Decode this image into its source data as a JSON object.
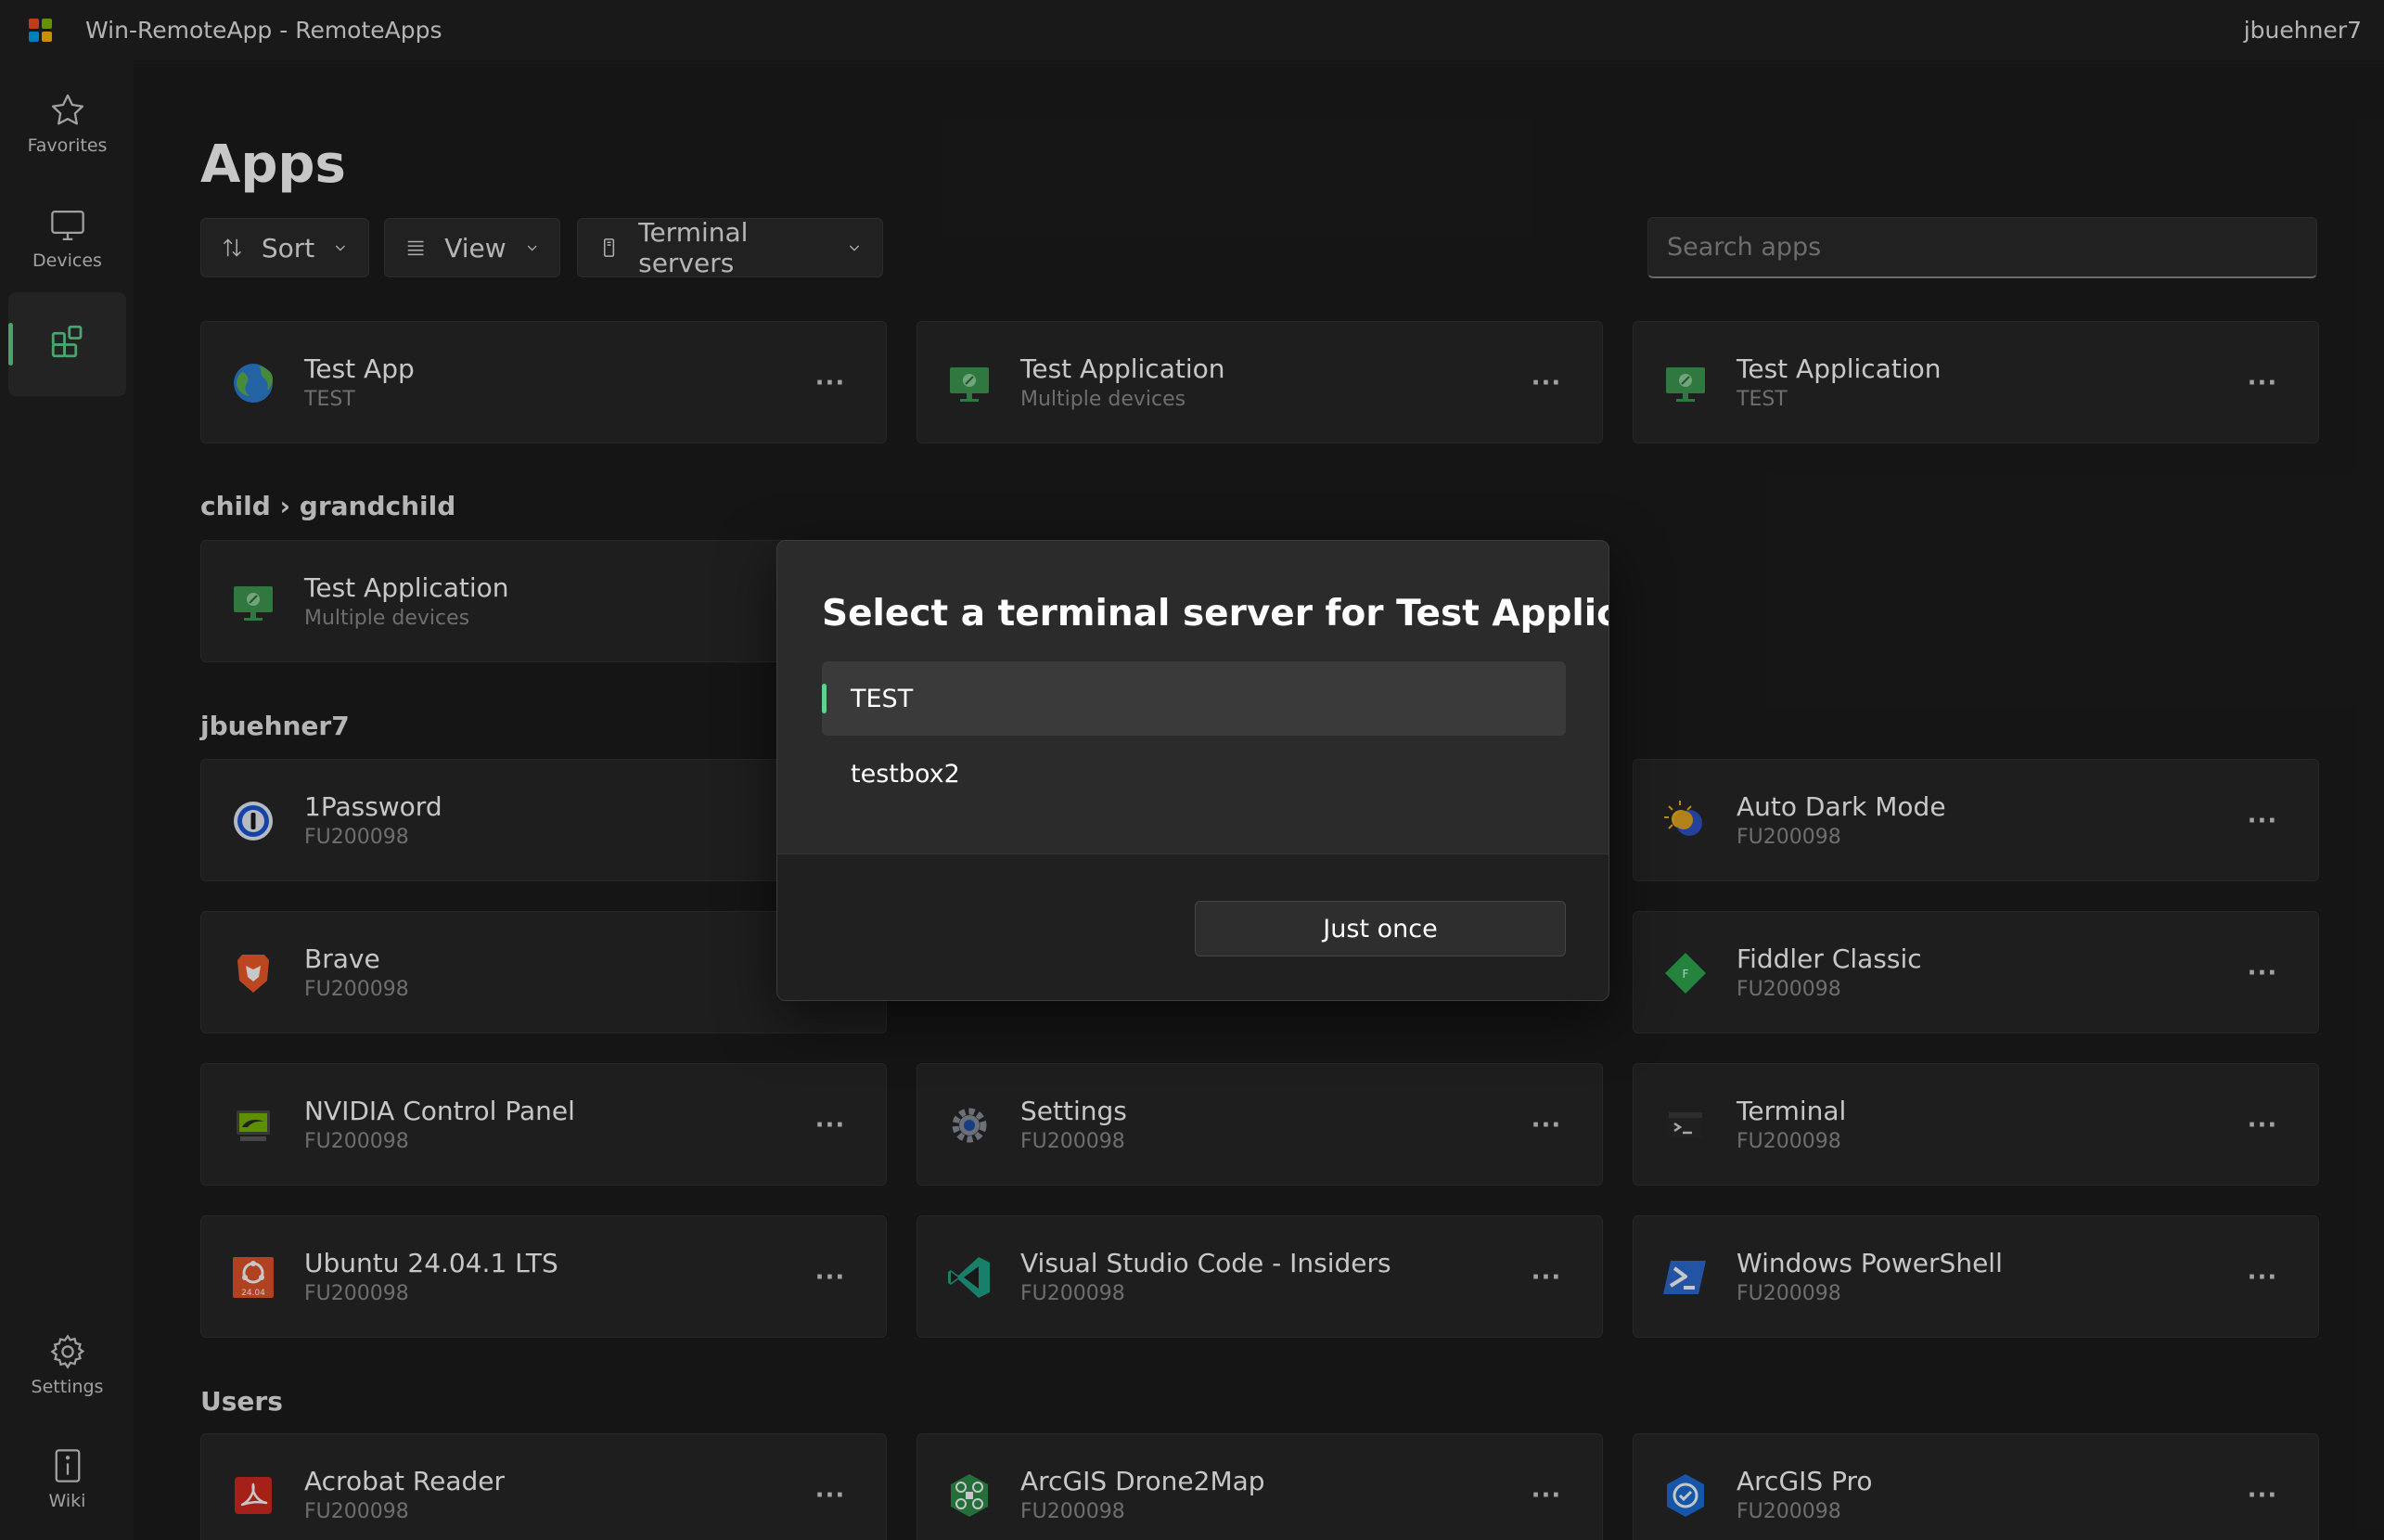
{
  "window": {
    "title": "Win-RemoteApp - RemoteApps",
    "user": "jbuehner7"
  },
  "sidebar": {
    "items": [
      {
        "label": "Favorites",
        "icon": "star-icon"
      },
      {
        "label": "Devices",
        "icon": "monitor-icon"
      },
      {
        "label": "",
        "icon": "apps-icon",
        "active": true
      },
      {
        "label": "Settings",
        "icon": "gear-icon"
      },
      {
        "label": "Wiki",
        "icon": "info-icon"
      }
    ]
  },
  "main": {
    "title": "Apps",
    "toolbar": {
      "sort_label": "Sort",
      "view_label": "View",
      "servers_label": "Terminal servers"
    },
    "search": {
      "placeholder": "Search apps",
      "value": ""
    },
    "sections": [
      {
        "label": ""
      },
      {
        "label": "child › grandchild"
      },
      {
        "label": "jbuehner7"
      },
      {
        "label": "Users"
      }
    ],
    "cards": [
      {
        "name": "Test App",
        "sub": "TEST",
        "icon": "globe-icon"
      },
      {
        "name": "Test Application",
        "sub": "Multiple devices",
        "icon": "remote-desktop-icon"
      },
      {
        "name": "Test Application",
        "sub": "TEST",
        "icon": "remote-desktop-icon"
      },
      {
        "name": "Test Application",
        "sub": "Multiple devices",
        "icon": "remote-desktop-icon"
      },
      {
        "name": "1Password",
        "sub": "FU200098",
        "icon": "onepassword-icon"
      },
      {
        "name": "Auto Dark Mode",
        "sub": "FU200098",
        "icon": "sun-moon-icon"
      },
      {
        "name": "Brave",
        "sub": "FU200098",
        "icon": "brave-lion-icon"
      },
      {
        "name": "Fiddler Classic",
        "sub": "FU200098",
        "icon": "fiddler-diamond-icon"
      },
      {
        "name": "NVIDIA Control Panel",
        "sub": "FU200098",
        "icon": "nvidia-icon"
      },
      {
        "name": "Settings",
        "sub": "FU200098",
        "icon": "cog-icon"
      },
      {
        "name": "Terminal",
        "sub": "FU200098",
        "icon": "terminal-icon"
      },
      {
        "name": "Ubuntu 24.04.1 LTS",
        "sub": "FU200098",
        "icon": "ubuntu-icon",
        "badge": "24.04"
      },
      {
        "name": "Visual Studio Code - Insiders",
        "sub": "FU200098",
        "icon": "vscode-icon"
      },
      {
        "name": "Windows PowerShell",
        "sub": "FU200098",
        "icon": "powershell-icon"
      },
      {
        "name": "Acrobat Reader",
        "sub": "FU200098",
        "icon": "acrobat-icon"
      },
      {
        "name": "ArcGIS Drone2Map",
        "sub": "FU200098",
        "icon": "drone-icon"
      },
      {
        "name": "ArcGIS Pro",
        "sub": "FU200098",
        "icon": "arcgis-pro-icon"
      }
    ],
    "more_glyph": "···"
  },
  "dialog": {
    "title": "Select a terminal server for Test Application",
    "options": [
      {
        "label": "TEST",
        "selected": true
      },
      {
        "label": "testbox2",
        "selected": false
      }
    ],
    "button": "Just once"
  },
  "colors": {
    "accent": "#5fd38c",
    "background": "#1c1c1c",
    "card": "#272727",
    "dialog": "#2b2b2b"
  }
}
